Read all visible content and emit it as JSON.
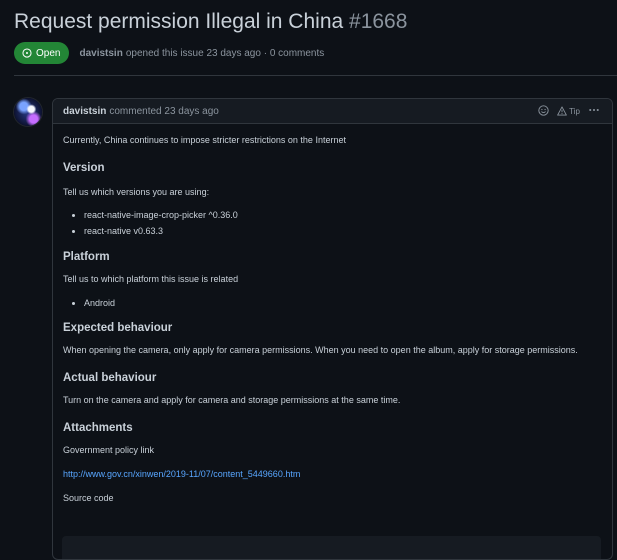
{
  "issue": {
    "title": "Request permission Illegal in China",
    "number": "#1668",
    "status": "Open",
    "author": "davistsin",
    "opened_text": "opened this issue 23 days ago · 0 comments"
  },
  "comment": {
    "author": "davistsin",
    "commented_text": "commented 23 days ago",
    "tip_label": "Tip",
    "intro": "Currently, China continues to impose stricter restrictions on the Internet",
    "version_heading": "Version",
    "version_text": "Tell us which versions you are using:",
    "versions": [
      "react-native-image-crop-picker ^0.36.0",
      "react-native v0.63.3"
    ],
    "platform_heading": "Platform",
    "platform_text": "Tell us to which platform this issue is related",
    "platforms": [
      "Android"
    ],
    "expected_heading": "Expected behaviour",
    "expected_text": "When opening the camera, only apply for camera permissions. When you need to open the album, apply for storage permissions.",
    "actual_heading": "Actual behaviour",
    "actual_text": "Turn on the camera and apply for camera and storage permissions at the same time.",
    "attachments_heading": "Attachments",
    "policy_label": "Government policy link",
    "policy_link": "http://www.gov.cn/xinwen/2019-11/07/content_5449660.htm",
    "source_label": "Source code"
  },
  "colors": {
    "background": "#0d1117",
    "open_badge": "#238636",
    "link": "#58a6ff",
    "border": "#30363d"
  },
  "icons": [
    "issue-opened-icon",
    "smiley-icon",
    "alert-icon",
    "kebab-icon"
  ]
}
